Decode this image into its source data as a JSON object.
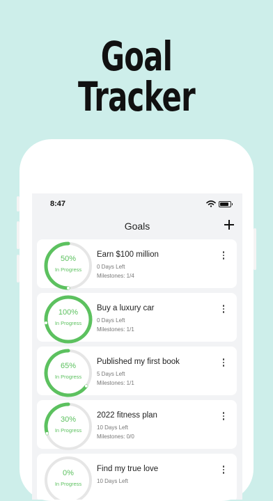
{
  "hero": {
    "title": "Goal Tracker"
  },
  "status_bar": {
    "time": "8:47"
  },
  "nav": {
    "title": "Goals"
  },
  "colors": {
    "background": "#cdeeea",
    "progress": "#5cc15f",
    "track": "#e6e6e6",
    "card": "#ffffff"
  },
  "goals": [
    {
      "percent_label": "50%",
      "progress": 0.5,
      "status": "In Progress",
      "title": "Earn $100 million",
      "days_left": "0 Days Left",
      "milestones": "Milestones: 1/4"
    },
    {
      "percent_label": "100%",
      "progress": 1.0,
      "status": "In Progress",
      "title": "Buy a luxury car",
      "days_left": "0 Days Left",
      "milestones": "Milestones: 1/1"
    },
    {
      "percent_label": "65%",
      "progress": 0.65,
      "status": "In Progress",
      "title": "Published my first book",
      "days_left": "5 Days Left",
      "milestones": "Milestones: 1/1"
    },
    {
      "percent_label": "30%",
      "progress": 0.3,
      "status": "In Progress",
      "title": "2022 fitness plan",
      "days_left": "10 Days Left",
      "milestones": "Milestones: 0/0"
    },
    {
      "percent_label": "0%",
      "progress": 0.0,
      "status": "In Progress",
      "title": "Find my true love",
      "days_left": "10 Days Left",
      "milestones": ""
    }
  ]
}
